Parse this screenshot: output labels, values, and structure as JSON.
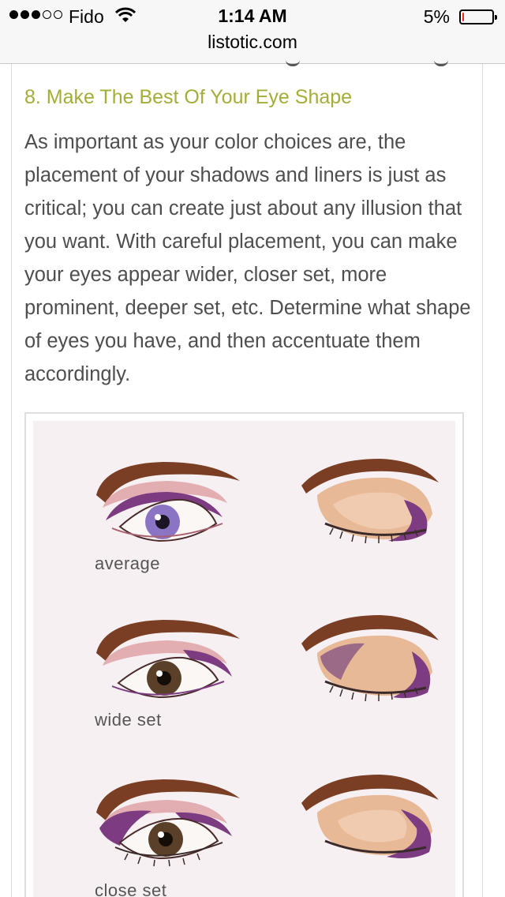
{
  "status_bar": {
    "carrier": "Fido",
    "time": "1:14 AM",
    "battery_percent": "5%",
    "battery_level": 0.05,
    "signal_bars_full": 3,
    "signal_bars_total": 5,
    "wifi_icon": "wifi-icon",
    "battery_color": "#e22a1c"
  },
  "browser": {
    "url": "listotic.com"
  },
  "article": {
    "heading": "8. Make The Best Of Your Eye Shape",
    "heading_color": "#a3ad38",
    "body": "As important as your color choices are, the placement of your shadows and liners is just as critical; you can create just about any illusion that you want. With careful placement, you can make your eyes appear wider, closer set, more prominent, deeper set, etc. Determine what shape of eyes you have, and then accentuate them accordingly.",
    "body_color": "#4e4e4e"
  },
  "figure": {
    "rows": [
      {
        "caption": "average",
        "iris_color": "#8c74c4"
      },
      {
        "caption": "wide set",
        "iris_color": "#5a4028"
      },
      {
        "caption": "close set",
        "iris_color": "#5a4028"
      }
    ],
    "colors": {
      "brow": "#7a3e24",
      "shadow": "#7d3c82",
      "skin": "#eec8ae",
      "lid": "#e7b996"
    }
  }
}
